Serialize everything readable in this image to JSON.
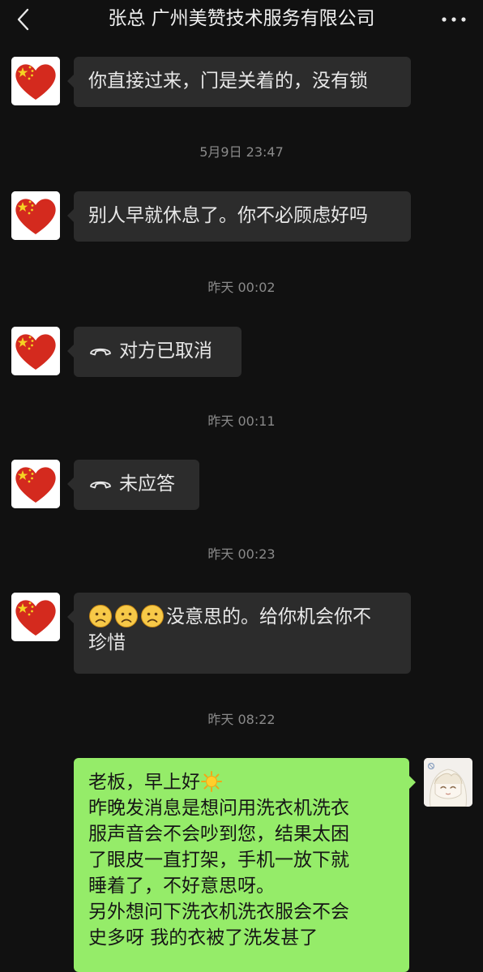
{
  "header": {
    "title": "张总 广州美赞技术服务有限公司",
    "back_icon": "chevron-left-icon",
    "more_icon": "more-horizontal-icon"
  },
  "colors": {
    "background": "#111111",
    "incoming_bubble": "#2c2c2c",
    "outgoing_bubble": "#95ec69",
    "timestamp_text": "#8a8a8a"
  },
  "messages": [
    {
      "sender": "contact",
      "text": "你直接过来，门是关着的，没有锁"
    },
    {
      "type": "timestamp",
      "text": "5月9日 23:47"
    },
    {
      "sender": "contact",
      "text": "别人早就休息了。你不必顾虑好吗"
    },
    {
      "type": "timestamp",
      "text": "昨天 00:02"
    },
    {
      "sender": "contact",
      "type": "call",
      "icon": "phone-hangup-icon",
      "text": "对方已取消"
    },
    {
      "type": "timestamp",
      "text": "昨天 00:11"
    },
    {
      "sender": "contact",
      "type": "call",
      "icon": "phone-hangup-icon",
      "text": "未应答"
    },
    {
      "type": "timestamp",
      "text": "昨天 00:23"
    },
    {
      "sender": "contact",
      "emojis": [
        "frown-emoji",
        "frown-emoji",
        "frown-emoji"
      ],
      "line1": "没意思的。给你机会你不",
      "line2": "珍惜"
    },
    {
      "type": "timestamp",
      "text": "昨天 08:22"
    },
    {
      "sender": "me",
      "lines": [
        "老板，早上好",
        "昨晚发消息是想问用洗衣机洗衣",
        "服声音会不会吵到您，结果太困",
        "了眼皮一直打架，手机一放下就",
        "睡着了，不好意思呀。",
        "另外想问下洗衣机洗衣服会不会",
        "史多呀 我的衣被了洗发甚了"
      ],
      "emoji_after_line1": "sun-emoji"
    }
  ]
}
